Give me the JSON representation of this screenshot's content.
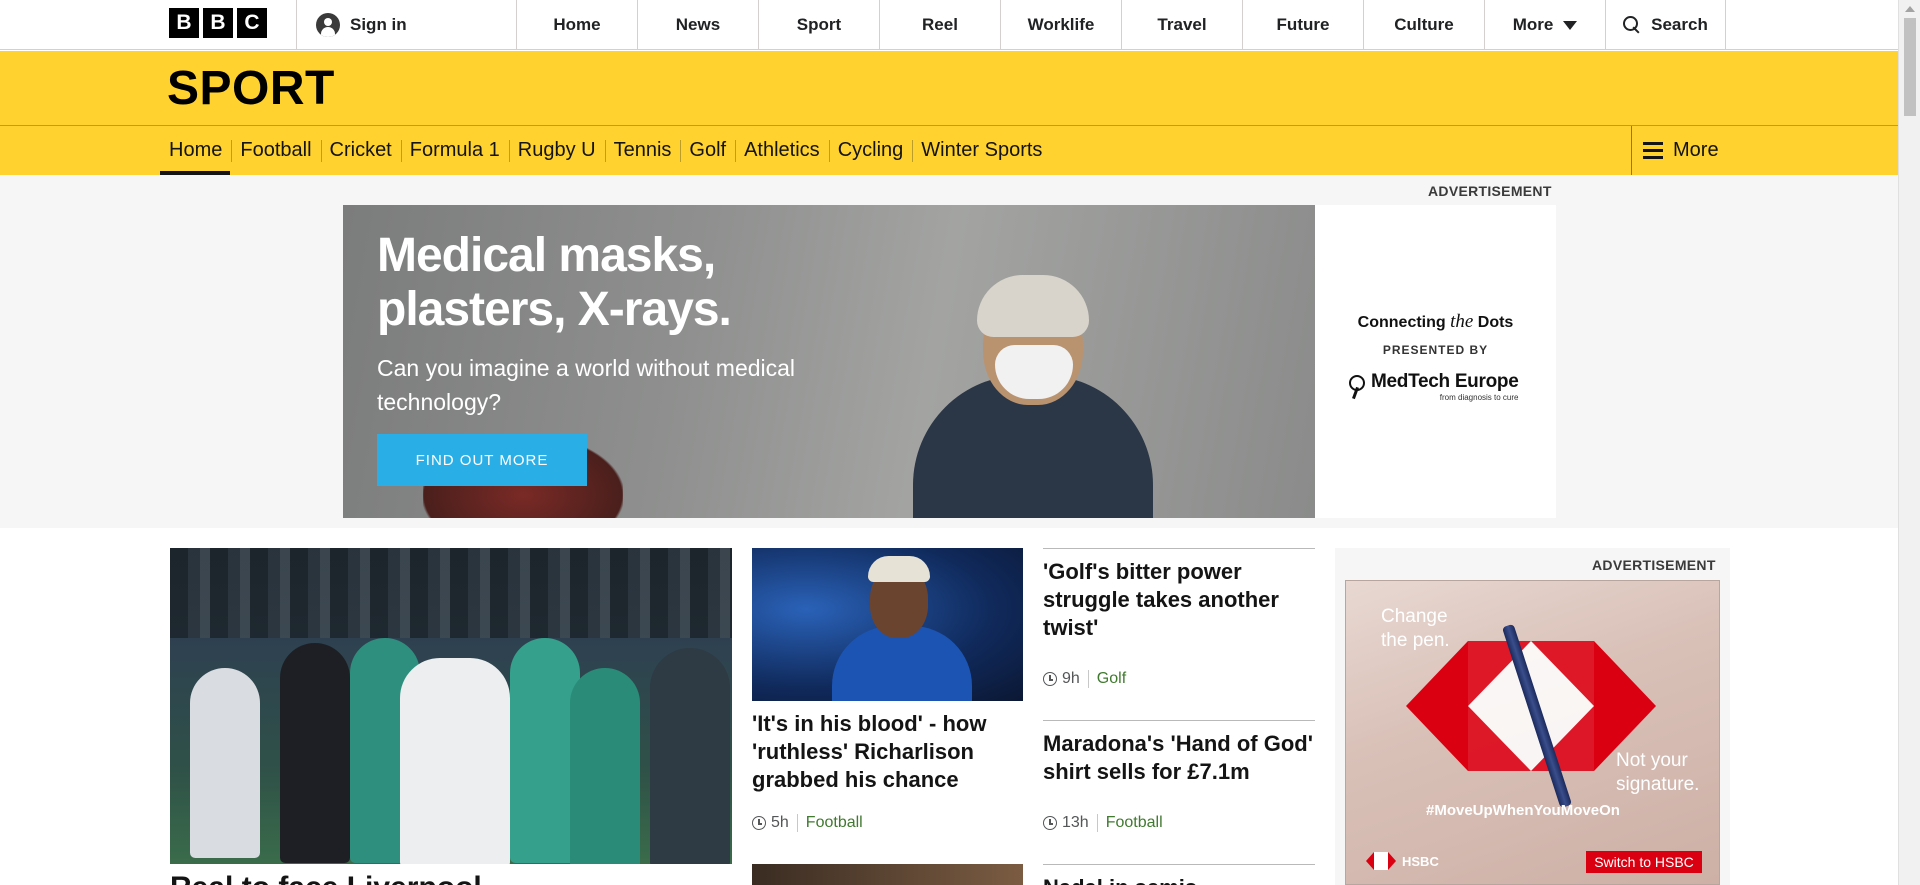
{
  "bbc": {
    "logo_letters": [
      "B",
      "B",
      "C"
    ],
    "sign_in": "Sign in",
    "nav": [
      "Home",
      "News",
      "Sport",
      "Reel",
      "Worklife",
      "Travel",
      "Future",
      "Culture"
    ],
    "more": "More",
    "search": "Search"
  },
  "sport": {
    "title": "SPORT",
    "nav": [
      "Home",
      "Football",
      "Cricket",
      "Formula 1",
      "Rugby U",
      "Tennis",
      "Golf",
      "Athletics",
      "Cycling",
      "Winter Sports"
    ],
    "active": "Home",
    "more": "More",
    "band_color": "#ffd230"
  },
  "top_ad": {
    "label": "ADVERTISEMENT",
    "headline": "Medical masks, plasters, X-rays.",
    "sub": "Can you imagine a world without medical technology?",
    "cta": "FIND OUT MORE",
    "side_title_pre": "Connecting ",
    "side_title_em": "the",
    "side_title_post": " Dots",
    "presented_by": "PRESENTED BY",
    "brand": "MedTech Europe",
    "brand_tag": "from diagnosis to cure"
  },
  "stories": {
    "lead": {
      "headline": "Real to face Liverpool"
    },
    "richarlison": {
      "headline": "'It's in his blood' - how 'ruthless' Richarlison grabbed his chance",
      "time": "5h",
      "section": "Football"
    },
    "golf": {
      "headline": "'Golf's bitter power struggle takes another twist'",
      "time": "9h",
      "section": "Golf"
    },
    "maradona": {
      "headline": "Maradona's 'Hand of God' shirt sells for £7.1m",
      "time": "13h",
      "section": "Football"
    },
    "next_partial": "Nadal in semis"
  },
  "right_ad": {
    "label": "ADVERTISEMENT",
    "change": "Change the pen.",
    "not_your": "Not your signature.",
    "hashtag": "#MoveUpWhenYouMoveOn",
    "brand": "HSBC",
    "cta": "Switch to HSBC"
  },
  "colors": {
    "accent_red": "#db0011",
    "section_green": "#407a2f",
    "cta_blue": "#2aaee6"
  }
}
